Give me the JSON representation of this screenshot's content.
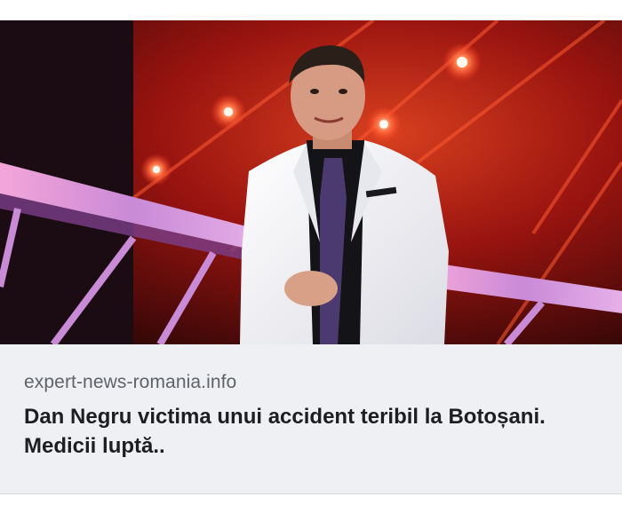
{
  "link_preview": {
    "image": {
      "alt": "",
      "description_icon": "person-photo"
    },
    "domain": "expert-news-romania.info",
    "headline": "Dan Negru victima unui accident teribil la Botoșani. Medicii luptă.."
  },
  "colors": {
    "card_background": "#eef0f3",
    "domain_text": "#5f6368",
    "headline_text": "#1c1e21",
    "stage_red": "#c2321a"
  }
}
